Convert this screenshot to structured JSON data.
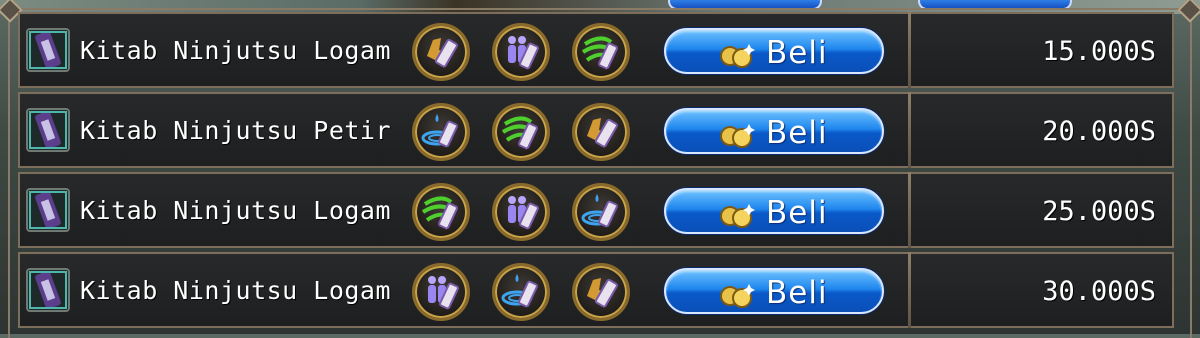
{
  "shop": {
    "buy_label": "Beli",
    "items": [
      {
        "name": "Kitab Ninjutsu Logam",
        "price": "15.000S",
        "badges": [
          "earth-scroll",
          "clone-scroll",
          "wind-scroll"
        ]
      },
      {
        "name": "Kitab Ninjutsu Petir",
        "price": "20.000S",
        "badges": [
          "water-scroll",
          "wind-scroll",
          "earth-scroll"
        ]
      },
      {
        "name": "Kitab Ninjutsu Logam",
        "price": "25.000S",
        "badges": [
          "wind-scroll",
          "clone-scroll",
          "water-scroll"
        ]
      },
      {
        "name": "Kitab Ninjutsu Logam",
        "price": "30.000S",
        "badges": [
          "clone-scroll",
          "water-scroll",
          "earth-scroll"
        ]
      }
    ]
  },
  "colors": {
    "button": "#1f86ee",
    "row_bg": "#1d1f20",
    "border": "#7c6e5a",
    "badge_ring": "#c9a34a"
  }
}
